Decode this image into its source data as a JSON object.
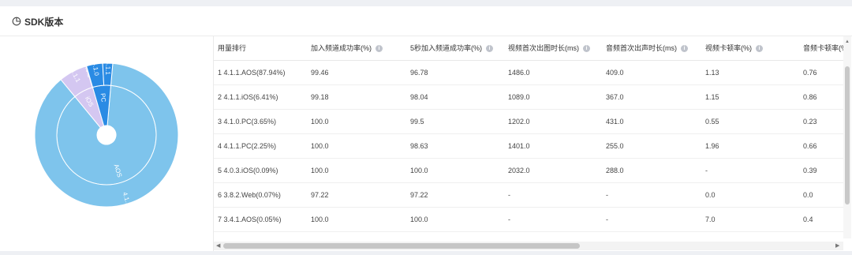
{
  "card": {
    "title": "SDK版本",
    "icon": "pie-chart-icon"
  },
  "chart_data": {
    "type": "pie",
    "rings": [
      {
        "name": "platform",
        "slices": [
          {
            "label": "AOS",
            "value": 87.99,
            "color": "#7ec4ec"
          },
          {
            "label": "iOS",
            "value": 6.5,
            "color": "#d4c7f1"
          },
          {
            "label": "PC",
            "value": 5.9,
            "color": "#2a8be4"
          }
        ]
      },
      {
        "name": "version",
        "slices": [
          {
            "label": "4.1.1",
            "value": 87.94,
            "color": "#7ec4ec"
          },
          {
            "label": "4.1.1",
            "value": 6.41,
            "color": "#d4c7f1"
          },
          {
            "label": "4.0.3",
            "value": 0.09,
            "color": "#d4c7f1"
          },
          {
            "label": "4.1.0",
            "value": 3.65,
            "color": "#2a8be4"
          },
          {
            "label": "4.1.1",
            "value": 2.25,
            "color": "#2a8be4"
          }
        ]
      }
    ]
  },
  "table": {
    "columns": [
      {
        "label": "用量排行",
        "info": false
      },
      {
        "label": "加入频道成功率(%)",
        "info": true
      },
      {
        "label": "5秒加入频道成功率(%)",
        "info": true
      },
      {
        "label": "视频首次出图时长(ms)",
        "info": true
      },
      {
        "label": "音频首次出声时长(ms)",
        "info": true
      },
      {
        "label": "视频卡顿率(%)",
        "info": true
      },
      {
        "label": "音频卡顿率(%)",
        "info": false
      }
    ],
    "rows": [
      [
        "1 4.1.1.AOS(87.94%)",
        "99.46",
        "96.78",
        "1486.0",
        "409.0",
        "1.13",
        "0.76"
      ],
      [
        "2 4.1.1.iOS(6.41%)",
        "99.18",
        "98.04",
        "1089.0",
        "367.0",
        "1.15",
        "0.86"
      ],
      [
        "3 4.1.0.PC(3.65%)",
        "100.0",
        "99.5",
        "1202.0",
        "431.0",
        "0.55",
        "0.23"
      ],
      [
        "4 4.1.1.PC(2.25%)",
        "100.0",
        "98.63",
        "1401.0",
        "255.0",
        "1.96",
        "0.66"
      ],
      [
        "5 4.0.3.iOS(0.09%)",
        "100.0",
        "100.0",
        "2032.0",
        "288.0",
        "-",
        "0.39"
      ],
      [
        "6 3.8.2.Web(0.07%)",
        "97.22",
        "97.22",
        "-",
        "-",
        "0.0",
        "0.0"
      ],
      [
        "7 3.4.1.AOS(0.05%)",
        "100.0",
        "100.0",
        "-",
        "-",
        "7.0",
        "0.4"
      ]
    ]
  }
}
